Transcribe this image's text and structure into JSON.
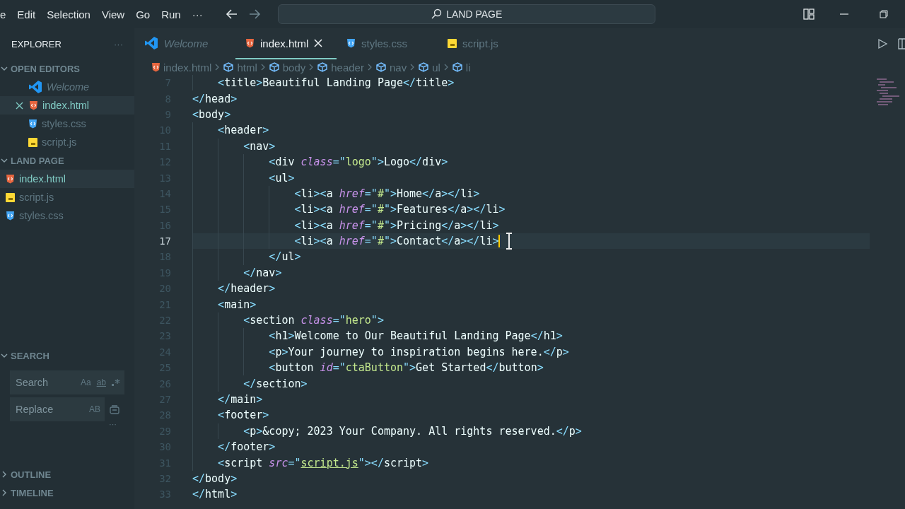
{
  "menu": [
    "e",
    "Edit",
    "Selection",
    "View",
    "Go",
    "Run",
    "···"
  ],
  "command_center": "LAND PAGE",
  "sidebar": {
    "title": "EXPLORER",
    "more": "···",
    "sections": [
      {
        "title": "OPEN EDITORS",
        "expanded": true,
        "kind": "files",
        "items": [
          {
            "name": "Welcome",
            "kind": "welcome",
            "selected": false,
            "close": false
          },
          {
            "name": "index.html",
            "kind": "html",
            "selected": true,
            "close": true
          },
          {
            "name": "styles.css",
            "kind": "css",
            "selected": false,
            "close": false
          },
          {
            "name": "script.js",
            "kind": "js",
            "selected": false,
            "close": false
          }
        ]
      },
      {
        "title": "LAND PAGE",
        "expanded": true,
        "kind": "tree",
        "items": [
          {
            "name": "index.html",
            "kind": "html",
            "selected": true,
            "close": false
          },
          {
            "name": "script.js",
            "kind": "js",
            "selected": false,
            "close": false
          },
          {
            "name": "styles.css",
            "kind": "css",
            "selected": false,
            "close": false
          }
        ]
      }
    ],
    "search": {
      "title": "SEARCH",
      "expanded": true,
      "search_placeholder": "Search",
      "match_case": "Aa",
      "whole_word": "ab",
      "replace_placeholder": "Replace",
      "preserve_case": "AB",
      "more": "···"
    },
    "bottom_sections": [
      {
        "title": "OUTLINE",
        "expanded": false
      },
      {
        "title": "TIMELINE",
        "expanded": false
      }
    ]
  },
  "tabs": [
    {
      "label": "Welcome",
      "kind": "welcome",
      "selected": false
    },
    {
      "label": "index.html",
      "kind": "html",
      "selected": true
    },
    {
      "label": "styles.css",
      "kind": "css",
      "selected": false
    },
    {
      "label": "script.js",
      "kind": "js",
      "selected": false
    }
  ],
  "breadcrumbs": [
    {
      "label": "index.html",
      "kind": "html"
    },
    {
      "label": "html",
      "kind": "element"
    },
    {
      "label": "body",
      "kind": "element"
    },
    {
      "label": "header",
      "kind": "element"
    },
    {
      "label": "nav",
      "kind": "element"
    },
    {
      "label": "ul",
      "kind": "element"
    },
    {
      "label": "li",
      "kind": "element"
    }
  ],
  "lines": [
    {
      "children": [
        {
          "number": "7",
          "selected": false,
          "tokens": [
            {
              "kind": "punct",
              "text": "<"
            },
            {
              "kind": "tag",
              "text": "title"
            },
            {
              "kind": "punct",
              "text": ">"
            },
            {
              "kind": "text",
              "text": "Beautiful Landing Page"
            },
            {
              "kind": "punct",
              "text": "</"
            },
            {
              "kind": "tag",
              "text": "title"
            },
            {
              "kind": "punct",
              "text": ">"
            }
          ]
        }
      ]
    },
    {
      "number": "8",
      "selected": false,
      "tokens": [
        {
          "kind": "punct",
          "text": "</"
        },
        {
          "kind": "tag",
          "text": "head"
        },
        {
          "kind": "punct",
          "text": ">"
        }
      ]
    },
    {
      "number": "9",
      "selected": false,
      "tokens": [
        {
          "kind": "punct",
          "text": "<"
        },
        {
          "kind": "tag",
          "text": "body"
        },
        {
          "kind": "punct",
          "text": ">"
        }
      ],
      "children": [
        {
          "number": "10",
          "selected": false,
          "tokens": [
            {
              "kind": "punct",
              "text": "<"
            },
            {
              "kind": "tag",
              "text": "header"
            },
            {
              "kind": "punct",
              "text": ">"
            }
          ],
          "children": [
            {
              "number": "11",
              "selected": false,
              "tokens": [
                {
                  "kind": "punct",
                  "text": "<"
                },
                {
                  "kind": "tag",
                  "text": "nav"
                },
                {
                  "kind": "punct",
                  "text": ">"
                }
              ],
              "children": [
                {
                  "number": "12",
                  "selected": false,
                  "tokens": [
                    {
                      "kind": "punct",
                      "text": "<"
                    },
                    {
                      "kind": "tag",
                      "text": "div"
                    },
                    {
                      "kind": "attr",
                      "text": " class"
                    },
                    {
                      "kind": "punct",
                      "text": "=\""
                    },
                    {
                      "kind": "string",
                      "text": "logo"
                    },
                    {
                      "kind": "punct",
                      "text": "\">"
                    },
                    {
                      "kind": "text",
                      "text": "Logo"
                    },
                    {
                      "kind": "punct",
                      "text": "</"
                    },
                    {
                      "kind": "tag",
                      "text": "div"
                    },
                    {
                      "kind": "punct",
                      "text": ">"
                    }
                  ]
                },
                {
                  "number": "13",
                  "selected": false,
                  "tokens": [
                    {
                      "kind": "punct",
                      "text": "<"
                    },
                    {
                      "kind": "tag",
                      "text": "ul"
                    },
                    {
                      "kind": "punct",
                      "text": ">"
                    }
                  ],
                  "children": [
                    {
                      "number": "14",
                      "selected": false,
                      "tokens": [
                        {
                          "kind": "punct",
                          "text": "<"
                        },
                        {
                          "kind": "tag",
                          "text": "li"
                        },
                        {
                          "kind": "punct",
                          "text": "><"
                        },
                        {
                          "kind": "tag",
                          "text": "a"
                        },
                        {
                          "kind": "attr",
                          "text": " href"
                        },
                        {
                          "kind": "punct",
                          "text": "=\""
                        },
                        {
                          "kind": "string",
                          "text": "#"
                        },
                        {
                          "kind": "punct",
                          "text": "\">"
                        },
                        {
                          "kind": "text",
                          "text": "Home"
                        },
                        {
                          "kind": "punct",
                          "text": "</"
                        },
                        {
                          "kind": "tag",
                          "text": "a"
                        },
                        {
                          "kind": "punct",
                          "text": "></"
                        },
                        {
                          "kind": "tag",
                          "text": "li"
                        },
                        {
                          "kind": "punct",
                          "text": ">"
                        }
                      ]
                    },
                    {
                      "number": "15",
                      "selected": false,
                      "tokens": [
                        {
                          "kind": "punct",
                          "text": "<"
                        },
                        {
                          "kind": "tag",
                          "text": "li"
                        },
                        {
                          "kind": "punct",
                          "text": "><"
                        },
                        {
                          "kind": "tag",
                          "text": "a"
                        },
                        {
                          "kind": "attr",
                          "text": " href"
                        },
                        {
                          "kind": "punct",
                          "text": "=\""
                        },
                        {
                          "kind": "string",
                          "text": "#"
                        },
                        {
                          "kind": "punct",
                          "text": "\">"
                        },
                        {
                          "kind": "text",
                          "text": "Features"
                        },
                        {
                          "kind": "punct",
                          "text": "</"
                        },
                        {
                          "kind": "tag",
                          "text": "a"
                        },
                        {
                          "kind": "punct",
                          "text": "></"
                        },
                        {
                          "kind": "tag",
                          "text": "li"
                        },
                        {
                          "kind": "punct",
                          "text": ">"
                        }
                      ]
                    },
                    {
                      "number": "16",
                      "selected": false,
                      "tokens": [
                        {
                          "kind": "punct",
                          "text": "<"
                        },
                        {
                          "kind": "tag",
                          "text": "li"
                        },
                        {
                          "kind": "punct",
                          "text": "><"
                        },
                        {
                          "kind": "tag",
                          "text": "a"
                        },
                        {
                          "kind": "attr",
                          "text": " href"
                        },
                        {
                          "kind": "punct",
                          "text": "=\""
                        },
                        {
                          "kind": "string",
                          "text": "#"
                        },
                        {
                          "kind": "punct",
                          "text": "\">"
                        },
                        {
                          "kind": "text",
                          "text": "Pricing"
                        },
                        {
                          "kind": "punct",
                          "text": "</"
                        },
                        {
                          "kind": "tag",
                          "text": "a"
                        },
                        {
                          "kind": "punct",
                          "text": "></"
                        },
                        {
                          "kind": "tag",
                          "text": "li"
                        },
                        {
                          "kind": "punct",
                          "text": ">"
                        }
                      ]
                    },
                    {
                      "number": "17",
                      "selected": true,
                      "tokens": [
                        {
                          "kind": "punct",
                          "text": "<"
                        },
                        {
                          "kind": "tag",
                          "text": "li"
                        },
                        {
                          "kind": "punct",
                          "text": "><"
                        },
                        {
                          "kind": "tag",
                          "text": "a"
                        },
                        {
                          "kind": "attr",
                          "text": " href"
                        },
                        {
                          "kind": "punct",
                          "text": "=\""
                        },
                        {
                          "kind": "string",
                          "text": "#"
                        },
                        {
                          "kind": "punct",
                          "text": "\">"
                        },
                        {
                          "kind": "text",
                          "text": "Contact"
                        },
                        {
                          "kind": "punct",
                          "text": "</"
                        },
                        {
                          "kind": "tag",
                          "text": "a"
                        },
                        {
                          "kind": "punct",
                          "text": "></"
                        },
                        {
                          "kind": "tag",
                          "text": "li"
                        },
                        {
                          "kind": "punct",
                          "text": ">"
                        }
                      ]
                    }
                  ]
                },
                {
                  "number": "18",
                  "selected": false,
                  "tokens": [
                    {
                      "kind": "punct",
                      "text": "</"
                    },
                    {
                      "kind": "tag",
                      "text": "ul"
                    },
                    {
                      "kind": "punct",
                      "text": ">"
                    }
                  ]
                }
              ]
            },
            {
              "number": "19",
              "selected": false,
              "tokens": [
                {
                  "kind": "punct",
                  "text": "</"
                },
                {
                  "kind": "tag",
                  "text": "nav"
                },
                {
                  "kind": "punct",
                  "text": ">"
                }
              ]
            }
          ]
        },
        {
          "number": "20",
          "selected": false,
          "tokens": [
            {
              "kind": "punct",
              "text": "</"
            },
            {
              "kind": "tag",
              "text": "header"
            },
            {
              "kind": "punct",
              "text": ">"
            }
          ]
        },
        {
          "number": "21",
          "selected": false,
          "tokens": [
            {
              "kind": "punct",
              "text": "<"
            },
            {
              "kind": "tag",
              "text": "main"
            },
            {
              "kind": "punct",
              "text": ">"
            }
          ],
          "children": [
            {
              "number": "22",
              "selected": false,
              "tokens": [
                {
                  "kind": "punct",
                  "text": "<"
                },
                {
                  "kind": "tag",
                  "text": "section"
                },
                {
                  "kind": "attr",
                  "text": " class"
                },
                {
                  "kind": "punct",
                  "text": "=\""
                },
                {
                  "kind": "string",
                  "text": "hero"
                },
                {
                  "kind": "punct",
                  "text": "\">"
                }
              ],
              "children": [
                {
                  "number": "23",
                  "selected": false,
                  "tokens": [
                    {
                      "kind": "punct",
                      "text": "<"
                    },
                    {
                      "kind": "tag",
                      "text": "h1"
                    },
                    {
                      "kind": "punct",
                      "text": ">"
                    },
                    {
                      "kind": "text",
                      "text": "Welcome to Our Beautiful Landing Page"
                    },
                    {
                      "kind": "punct",
                      "text": "</"
                    },
                    {
                      "kind": "tag",
                      "text": "h1"
                    },
                    {
                      "kind": "punct",
                      "text": ">"
                    }
                  ]
                },
                {
                  "number": "24",
                  "selected": false,
                  "tokens": [
                    {
                      "kind": "punct",
                      "text": "<"
                    },
                    {
                      "kind": "tag",
                      "text": "p"
                    },
                    {
                      "kind": "punct",
                      "text": ">"
                    },
                    {
                      "kind": "text",
                      "text": "Your journey to inspiration begins here."
                    },
                    {
                      "kind": "punct",
                      "text": "</"
                    },
                    {
                      "kind": "tag",
                      "text": "p"
                    },
                    {
                      "kind": "punct",
                      "text": ">"
                    }
                  ]
                },
                {
                  "number": "25",
                  "selected": false,
                  "tokens": [
                    {
                      "kind": "punct",
                      "text": "<"
                    },
                    {
                      "kind": "tag",
                      "text": "button"
                    },
                    {
                      "kind": "attr",
                      "text": " id"
                    },
                    {
                      "kind": "punct",
                      "text": "=\""
                    },
                    {
                      "kind": "string",
                      "text": "ctaButton"
                    },
                    {
                      "kind": "punct",
                      "text": "\">"
                    },
                    {
                      "kind": "text",
                      "text": "Get Started"
                    },
                    {
                      "kind": "punct",
                      "text": "</"
                    },
                    {
                      "kind": "tag",
                      "text": "button"
                    },
                    {
                      "kind": "punct",
                      "text": ">"
                    }
                  ]
                }
              ]
            },
            {
              "number": "26",
              "selected": false,
              "tokens": [
                {
                  "kind": "punct",
                  "text": "</"
                },
                {
                  "kind": "tag",
                  "text": "section"
                },
                {
                  "kind": "punct",
                  "text": ">"
                }
              ]
            }
          ]
        },
        {
          "number": "27",
          "selected": false,
          "tokens": [
            {
              "kind": "punct",
              "text": "</"
            },
            {
              "kind": "tag",
              "text": "main"
            },
            {
              "kind": "punct",
              "text": ">"
            }
          ]
        },
        {
          "number": "28",
          "selected": false,
          "tokens": [
            {
              "kind": "punct",
              "text": "<"
            },
            {
              "kind": "tag",
              "text": "footer"
            },
            {
              "kind": "punct",
              "text": ">"
            }
          ],
          "children": [
            {
              "number": "29",
              "selected": false,
              "tokens": [
                {
                  "kind": "punct",
                  "text": "<"
                },
                {
                  "kind": "tag",
                  "text": "p"
                },
                {
                  "kind": "punct",
                  "text": ">"
                },
                {
                  "kind": "text",
                  "text": "&copy; 2023 Your Company. All rights reserved."
                },
                {
                  "kind": "punct",
                  "text": "</"
                },
                {
                  "kind": "tag",
                  "text": "p"
                },
                {
                  "kind": "punct",
                  "text": ">"
                }
              ]
            }
          ]
        },
        {
          "number": "30",
          "selected": false,
          "tokens": [
            {
              "kind": "punct",
              "text": "</"
            },
            {
              "kind": "tag",
              "text": "footer"
            },
            {
              "kind": "punct",
              "text": ">"
            }
          ]
        },
        {
          "number": "31",
          "selected": false,
          "tokens": [
            {
              "kind": "punct",
              "text": "<"
            },
            {
              "kind": "tag",
              "text": "script"
            },
            {
              "kind": "attr",
              "text": " src"
            },
            {
              "kind": "punct",
              "text": "=\""
            },
            {
              "kind": "link",
              "text": "script.js"
            },
            {
              "kind": "punct",
              "text": "\"></"
            },
            {
              "kind": "tag",
              "text": "script"
            },
            {
              "kind": "punct",
              "text": ">"
            }
          ]
        }
      ]
    },
    {
      "number": "32",
      "selected": false,
      "tokens": [
        {
          "kind": "punct",
          "text": "</"
        },
        {
          "kind": "tag",
          "text": "body"
        },
        {
          "kind": "punct",
          "text": ">"
        }
      ]
    },
    {
      "number": "33",
      "selected": false,
      "tokens": [
        {
          "kind": "punct",
          "text": "</"
        },
        {
          "kind": "tag",
          "text": "html"
        },
        {
          "kind": "punct",
          "text": ">"
        }
      ]
    }
  ]
}
